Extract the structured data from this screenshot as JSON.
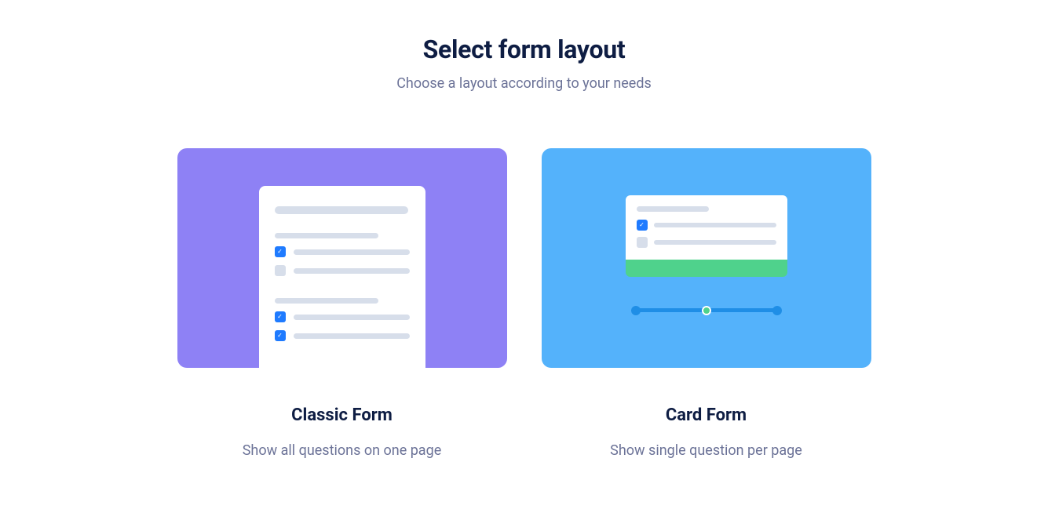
{
  "header": {
    "title": "Select form layout",
    "subtitle": "Choose a layout according to your needs"
  },
  "options": [
    {
      "id": "classic",
      "title": "Classic Form",
      "desc": "Show all questions on one page"
    },
    {
      "id": "card",
      "title": "Card Form",
      "desc": "Show single question per page"
    }
  ]
}
